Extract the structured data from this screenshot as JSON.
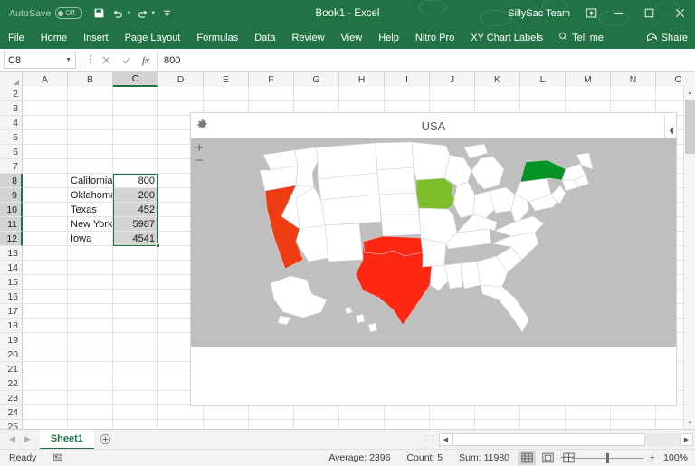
{
  "titlebar": {
    "autosave_label": "AutoSave",
    "autosave_state": "Off",
    "doc_title": "Book1  -  Excel",
    "team_name": "SillySac Team",
    "quick_access": [
      "save-icon",
      "undo-icon",
      "redo-icon",
      "customize-qat-icon"
    ],
    "window_buttons": [
      "ribbon-display-options",
      "minimize",
      "maximize",
      "close"
    ]
  },
  "ribbon": {
    "tabs": [
      "File",
      "Home",
      "Insert",
      "Page Layout",
      "Formulas",
      "Data",
      "Review",
      "View",
      "Help",
      "Nitro Pro",
      "XY Chart Labels"
    ],
    "tell_me": "Tell me",
    "share": "Share"
  },
  "formula_bar": {
    "name_box": "C8",
    "formula_value": "800",
    "cancel_icon": "cancel-icon",
    "confirm_icon": "confirm-icon",
    "function_icon": "fx"
  },
  "grid": {
    "columns": [
      "A",
      "B",
      "C",
      "D",
      "E",
      "F",
      "G",
      "H",
      "I",
      "J",
      "K",
      "L",
      "M",
      "N",
      "O"
    ],
    "selected_column": "C",
    "rows": [
      2,
      3,
      4,
      5,
      6,
      7,
      8,
      9,
      10,
      11,
      12,
      13,
      14,
      15,
      16,
      17,
      18,
      19,
      20,
      21,
      22,
      23,
      24,
      25
    ],
    "selected_rows": [
      8,
      9,
      10,
      11,
      12
    ],
    "data": [
      {
        "row": 8,
        "label": "California",
        "value": "800"
      },
      {
        "row": 9,
        "label": "Oklahoma",
        "value": "200"
      },
      {
        "row": 10,
        "label": "Texas",
        "value": "452"
      },
      {
        "row": 11,
        "label": "New York",
        "value": "5987"
      },
      {
        "row": 12,
        "label": "Iowa",
        "value": "4541"
      }
    ],
    "selection_range": "C8:C12",
    "active_cell": "C8"
  },
  "map_panel": {
    "title": "USA",
    "settings_icon": "gear-icon",
    "zoom_in": "+",
    "zoom_out": "−",
    "collapse_icon": "collapse-arrow-icon",
    "background_color": "#bfbfbf",
    "default_state_color": "#ffffff",
    "state_colors": [
      {
        "state": "California",
        "value": 800,
        "color": "#f03c12"
      },
      {
        "state": "Oklahoma",
        "value": 200,
        "color": "#fe2712"
      },
      {
        "state": "Texas",
        "value": 452,
        "color": "#fe2712"
      },
      {
        "state": "New York",
        "value": 5987,
        "color": "#069326"
      },
      {
        "state": "Iowa",
        "value": 4541,
        "color": "#7cbf2b"
      }
    ]
  },
  "sheet_tabs": {
    "tabs": [
      "Sheet1"
    ],
    "active": "Sheet1",
    "add_sheet_icon": "plus-icon",
    "nav_prev_icon": "prev-arrow-icon",
    "nav_next_icon": "next-arrow-icon"
  },
  "status_bar": {
    "status": "Ready",
    "macro_icon": "record-macro-icon",
    "average": "Average: 2396",
    "count": "Count: 5",
    "sum": "Sum: 11980",
    "views": [
      "normal-view-icon",
      "page-layout-view-icon",
      "page-break-view-icon"
    ],
    "active_view": "normal-view-icon",
    "zoom_out_sign": "−",
    "zoom_in_sign": "+",
    "zoom_level": "100%"
  },
  "chart_data": {
    "type": "map",
    "title": "USA",
    "categories": [
      "California",
      "Oklahoma",
      "Texas",
      "New York",
      "Iowa"
    ],
    "values": [
      800,
      200,
      452,
      5987,
      4541
    ],
    "colors": [
      "#f03c12",
      "#fe2712",
      "#fe2712",
      "#069326",
      "#7cbf2b"
    ],
    "ylabel": "",
    "xlabel": "",
    "legend": "none"
  }
}
